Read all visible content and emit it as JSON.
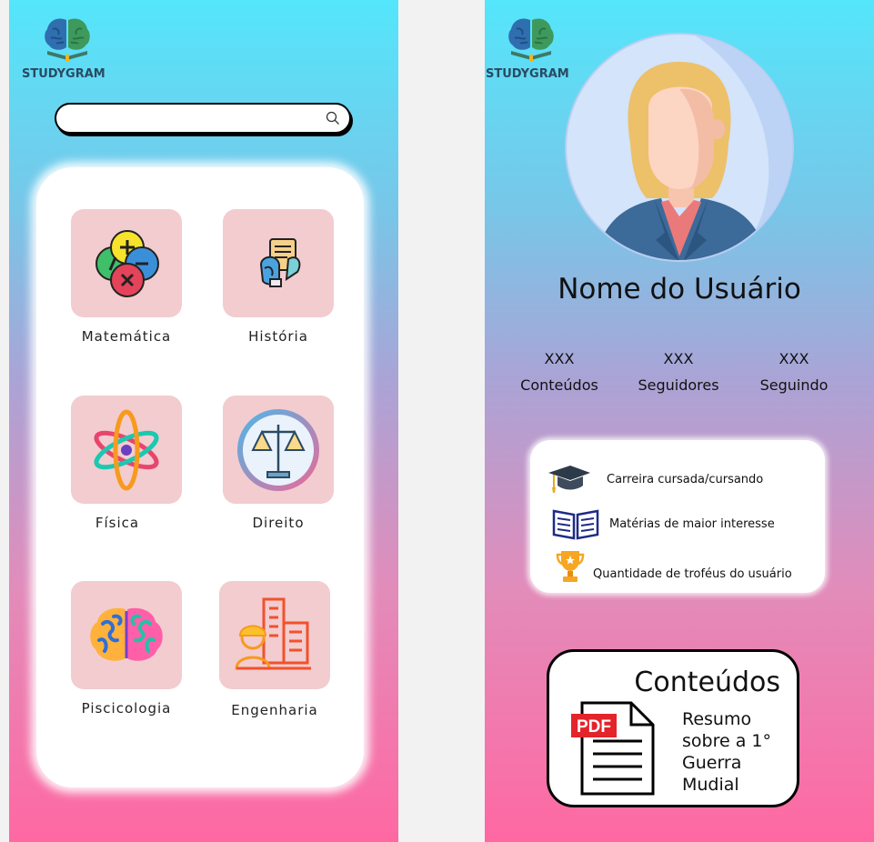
{
  "app": {
    "logo_text": "STUDYGRAM"
  },
  "colors": {
    "gradient_top": "#54e6fb",
    "gradient_bottom": "#ff68a2",
    "tile_bg": "#f2cccf"
  },
  "search": {
    "placeholder": "",
    "icon": "search-icon"
  },
  "subjects": [
    {
      "label": "Matemática",
      "icon": "math-operators-icon"
    },
    {
      "label": "História",
      "icon": "history-scroll-icon"
    },
    {
      "label": "Física",
      "icon": "atom-icon"
    },
    {
      "label": "Direito",
      "icon": "scales-of-justice-icon"
    },
    {
      "label": "Piscicologia",
      "icon": "brain-icon"
    },
    {
      "label": "Engenharia",
      "icon": "engineer-buildings-icon"
    }
  ],
  "profile": {
    "avatar_icon": "user-avatar-icon",
    "name": "Nome do Usuário",
    "stats": [
      {
        "value": "XXX",
        "label": "Conteúdos"
      },
      {
        "value": "XXX",
        "label": "Seguidores"
      },
      {
        "value": "XXX",
        "label": "Seguindo"
      }
    ],
    "info": [
      {
        "text": "Carreira cursada/cursando",
        "icon": "graduation-cap-icon"
      },
      {
        "text": "Matérias de maior interesse",
        "icon": "open-book-icon"
      },
      {
        "text": "Quantidade de troféus do usuário",
        "icon": "trophy-icon"
      }
    ]
  },
  "contents": {
    "title": "Conteúdos",
    "pdf_label": "PDF",
    "item_description": "Resumo sobre a 1° Guerra Mudial"
  }
}
